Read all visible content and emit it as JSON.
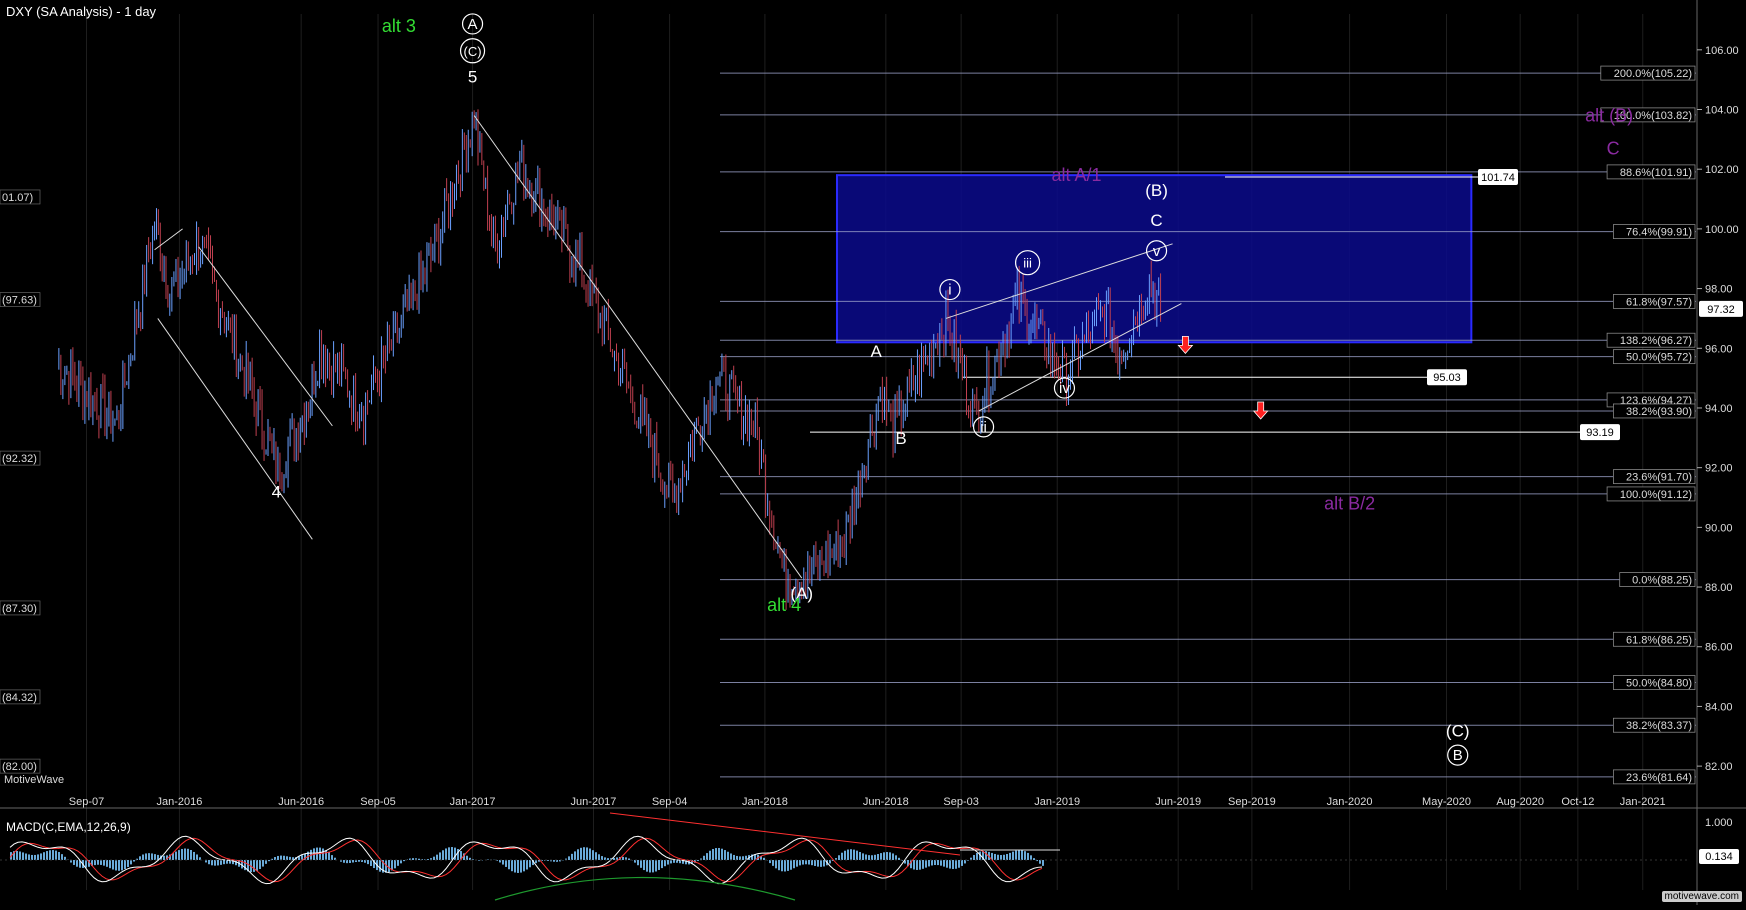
{
  "chart": {
    "title": "DXY (SA Analysis) - 1 day",
    "watermark_left": "MotiveWave",
    "watermark_right": "motivewave.com",
    "macd_label": "MACD(C,EMA,12,26,9)",
    "macd_last_value": "0.134",
    "macd_axis_label": "1.000",
    "last_price_label": "97.32",
    "colors": {
      "background": "#000000",
      "price_up": "#6aa0ff",
      "price_down": "#c04050",
      "fib_line": "#9aa0c8",
      "box_fill": "#0a0a8c",
      "box_border": "#2a2aff",
      "wave_white": "#ffffff",
      "wave_green": "#33dd33",
      "wave_purple": "#8a2aa0",
      "arrow_red": "#ff2020",
      "macd_line": "#ffffff",
      "macd_signal": "#ff3030",
      "macd_hist": "#6aaad8"
    }
  },
  "chart_data": {
    "type": "line",
    "title": "DXY (SA Analysis) - 1 day",
    "x_tick_labels": [
      "Sep-07",
      "Jan-2016",
      "Jun-2016",
      "Sep-05",
      "Jan-2017",
      "Jun-2017",
      "Sep-04",
      "Jan-2018",
      "Jun-2018",
      "Sep-03",
      "Jan-2019",
      "Jun-2019",
      "Sep-2019",
      "Jan-2020",
      "May-2020",
      "Aug-2020",
      "Oct-12",
      "Jan-2021"
    ],
    "y_tick_labels": [
      "106.00",
      "104.00",
      "102.00",
      "100.00",
      "98.00",
      "96.00",
      "94.00",
      "92.00",
      "90.00",
      "88.00",
      "86.00",
      "84.00",
      "82.00"
    ],
    "y_ticks": [
      106,
      104,
      102,
      100,
      98,
      96,
      94,
      92,
      90,
      88,
      86,
      84,
      82
    ],
    "ylim": [
      81.2,
      107.2
    ],
    "left_edge_labels": [
      {
        "text": "01.07)",
        "y": 101.07
      },
      {
        "text": "(97.63)",
        "y": 97.63
      },
      {
        "text": "(92.32)",
        "y": 92.32
      },
      {
        "text": "(87.30)",
        "y": 87.3
      },
      {
        "text": "(84.32)",
        "y": 84.32
      },
      {
        "text": "(82.00)",
        "y": 82.0
      }
    ],
    "price_anchors": [
      {
        "x": "2015-08-01",
        "y": 95.5
      },
      {
        "x": "2015-10-15",
        "y": 93.5
      },
      {
        "x": "2015-12-01",
        "y": 100.2
      },
      {
        "x": "2015-12-20",
        "y": 97.8
      },
      {
        "x": "2016-01-25",
        "y": 99.6
      },
      {
        "x": "2016-05-03",
        "y": 91.9
      },
      {
        "x": "2016-06-10",
        "y": 94.2
      },
      {
        "x": "2016-06-24",
        "y": 96.0
      },
      {
        "x": "2016-08-18",
        "y": 94.0
      },
      {
        "x": "2016-11-10",
        "y": 99.0
      },
      {
        "x": "2017-01-03",
        "y": 103.8
      },
      {
        "x": "2017-01-27",
        "y": 99.4
      },
      {
        "x": "2017-03-01",
        "y": 102.2
      },
      {
        "x": "2017-05-10",
        "y": 99.0
      },
      {
        "x": "2017-07-20",
        "y": 94.3
      },
      {
        "x": "2017-09-08",
        "y": 91.0
      },
      {
        "x": "2017-11-01",
        "y": 95.1
      },
      {
        "x": "2017-12-20",
        "y": 93.3
      },
      {
        "x": "2018-01-25",
        "y": 88.4
      },
      {
        "x": "2018-02-16",
        "y": 88.3
      },
      {
        "x": "2018-04-10",
        "y": 89.5
      },
      {
        "x": "2018-05-25",
        "y": 94.6
      },
      {
        "x": "2018-06-10",
        "y": 93.4
      },
      {
        "x": "2018-08-15",
        "y": 97.0
      },
      {
        "x": "2018-09-20",
        "y": 93.8
      },
      {
        "x": "2018-11-12",
        "y": 97.6
      },
      {
        "x": "2019-01-10",
        "y": 95.1
      },
      {
        "x": "2019-03-01",
        "y": 97.3
      },
      {
        "x": "2019-03-20",
        "y": 95.8
      },
      {
        "x": "2019-04-26",
        "y": 98.3
      },
      {
        "x": "2019-05-10",
        "y": 97.32
      }
    ],
    "fib_levels": [
      {
        "label": "200.0%(105.22)",
        "y": 105.22
      },
      {
        "label": "100.0%(103.82)",
        "y": 103.82
      },
      {
        "label": "88.6%(101.91)",
        "y": 101.91
      },
      {
        "label": "76.4%(99.91)",
        "y": 99.91
      },
      {
        "label": "61.8%(97.57)",
        "y": 97.57
      },
      {
        "label": "138.2%(96.27)",
        "y": 96.27
      },
      {
        "label": "50.0%(95.72)",
        "y": 95.72
      },
      {
        "label": "123.6%(94.27)",
        "y": 94.27
      },
      {
        "label": "38.2%(93.90)",
        "y": 93.9
      },
      {
        "label": "23.6%(91.70)",
        "y": 91.7
      },
      {
        "label": "100.0%(91.12)",
        "y": 91.12
      },
      {
        "label": "0.0%(88.25)",
        "y": 88.25
      },
      {
        "label": "61.8%(86.25)",
        "y": 86.25
      },
      {
        "label": "50.0%(84.80)",
        "y": 84.8
      },
      {
        "label": "38.2%(83.37)",
        "y": 83.37
      },
      {
        "label": "23.6%(81.64)",
        "y": 81.64
      }
    ],
    "level_labels": [
      {
        "label": "101.74",
        "y": 101.74
      },
      {
        "label": "95.03",
        "y": 95.03
      },
      {
        "label": "93.19",
        "y": 93.19
      }
    ],
    "target_box": {
      "x0": "2018-04-01",
      "x1": "2020-06-01",
      "y0": 96.2,
      "y1": 101.8
    },
    "wave_labels": [
      {
        "text": "A",
        "x": "2017-01-01",
        "y": 106.7,
        "circled": true,
        "color": "white"
      },
      {
        "text": "(C)",
        "x": "2017-01-01",
        "y": 105.8,
        "circled": true,
        "color": "white"
      },
      {
        "text": "5",
        "x": "2017-01-01",
        "y": 104.9,
        "circled": false,
        "color": "white"
      },
      {
        "text": "alt 3",
        "x": "2016-10-01",
        "y": 106.6,
        "circled": false,
        "color": "green"
      },
      {
        "text": "4",
        "x": "2016-05-01",
        "y": 91.0,
        "circled": false,
        "color": "white"
      },
      {
        "text": "(A)",
        "x": "2018-02-16",
        "y": 87.6,
        "circled": false,
        "color": "white"
      },
      {
        "text": "alt 4",
        "x": "2018-01-25",
        "y": 87.2,
        "circled": false,
        "color": "green"
      },
      {
        "text": "A",
        "x": "2018-05-20",
        "y": 95.7,
        "circled": false,
        "color": "white"
      },
      {
        "text": "B",
        "x": "2018-06-20",
        "y": 92.8,
        "circled": false,
        "color": "white"
      },
      {
        "text": "i",
        "x": "2018-08-20",
        "y": 97.8,
        "circled": true,
        "color": "white"
      },
      {
        "text": "ii",
        "x": "2018-10-01",
        "y": 93.2,
        "circled": true,
        "color": "white"
      },
      {
        "text": "iii",
        "x": "2018-11-25",
        "y": 98.7,
        "circled": true,
        "color": "white"
      },
      {
        "text": "iv",
        "x": "2019-01-10",
        "y": 94.5,
        "circled": true,
        "color": "white"
      },
      {
        "text": "v",
        "x": "2019-05-05",
        "y": 99.1,
        "circled": true,
        "color": "white"
      },
      {
        "text": "(B)",
        "x": "2019-05-05",
        "y": 101.1,
        "circled": false,
        "color": "white"
      },
      {
        "text": "C",
        "x": "2019-05-05",
        "y": 100.1,
        "circled": false,
        "color": "white"
      },
      {
        "text": "alt A/1",
        "x": "2019-01-25",
        "y": 101.6,
        "circled": false,
        "color": "purple"
      },
      {
        "text": "alt (B)",
        "x": "2020-11-20",
        "y": 103.6,
        "circled": false,
        "color": "purple"
      },
      {
        "text": "C",
        "x": "2020-11-25",
        "y": 102.5,
        "circled": false,
        "color": "purple"
      },
      {
        "text": "alt B/2",
        "x": "2020-01-01",
        "y": 90.6,
        "circled": false,
        "color": "purple"
      },
      {
        "text": "(C)",
        "x": "2020-05-15",
        "y": 83.0,
        "circled": false,
        "color": "white"
      },
      {
        "text": "B",
        "x": "2020-05-15",
        "y": 82.2,
        "circled": true,
        "color": "white"
      }
    ]
  }
}
